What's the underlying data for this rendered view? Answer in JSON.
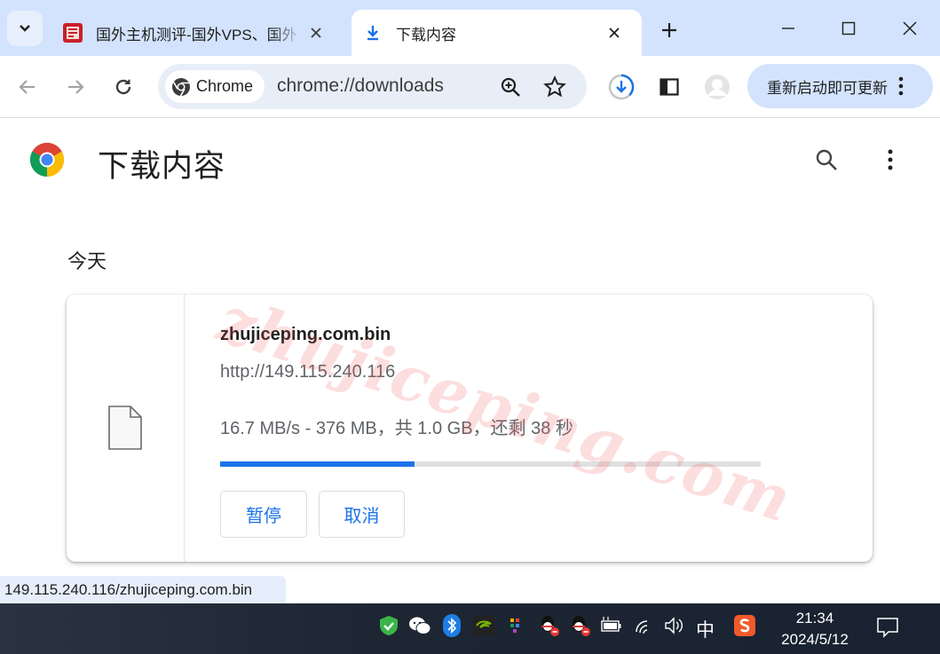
{
  "tabs": [
    {
      "title": "国外主机测评-国外VPS、国外"
    },
    {
      "title": "下载内容"
    }
  ],
  "omnibox": {
    "chip_label": "Chrome",
    "url": "chrome://downloads"
  },
  "update_button": {
    "label": "重新启动即可更新"
  },
  "page": {
    "title": "下载内容",
    "section": "今天"
  },
  "download": {
    "filename": "zhujiceping.com.bin",
    "source_url": "http://149.115.240.116",
    "status": "16.7 MB/s - 376 MB，共 1.0 GB，还剩 38 秒",
    "progress": 0.36,
    "pause_label": "暂停",
    "cancel_label": "取消"
  },
  "watermark": "zhujiceping.com",
  "status_bar": "149.115.240.116/zhujiceping.com.bin",
  "taskbar": {
    "ime": "中",
    "time": "21:34",
    "date": "2024/5/12"
  },
  "colors": {
    "accent": "#1a73e8",
    "tabstrip": "#d3e3fd"
  }
}
